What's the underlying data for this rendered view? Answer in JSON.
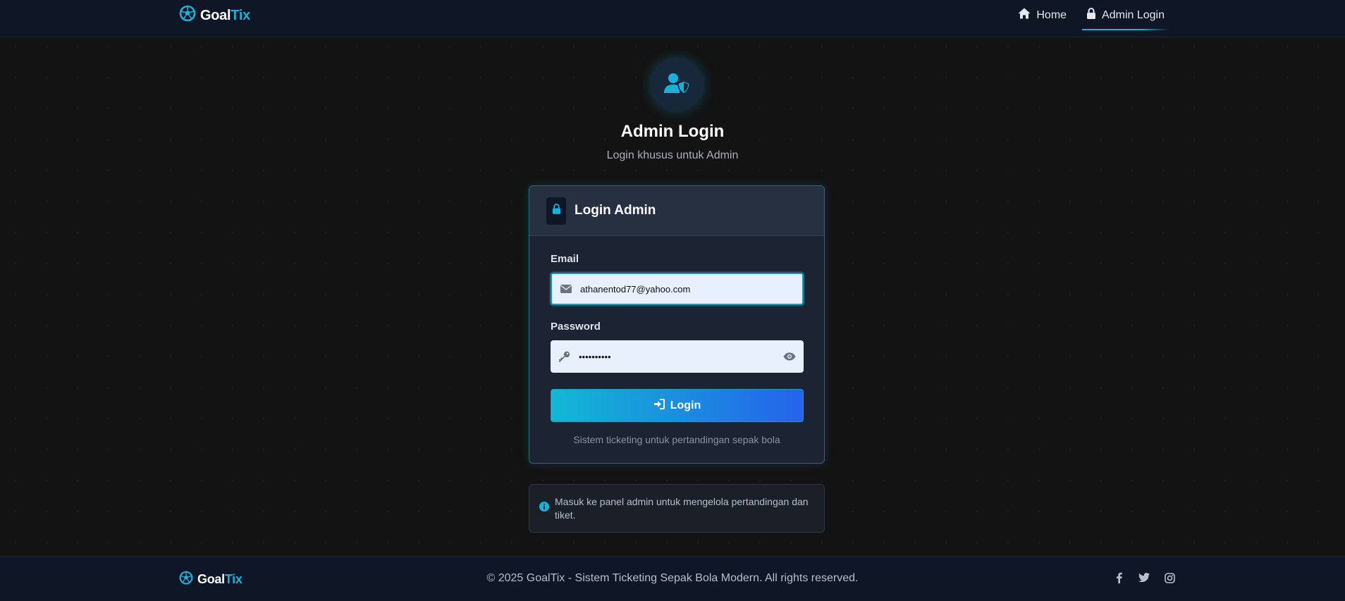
{
  "nav": {
    "brand_part1": "Goal",
    "brand_part2": "Tix",
    "links": [
      {
        "label": "Home",
        "icon": "home-icon"
      },
      {
        "label": "Admin Login",
        "icon": "lock-icon",
        "active": true
      }
    ]
  },
  "hero": {
    "icon": "user-shield-icon",
    "title": "Admin Login",
    "subtitle": "Login khusus untuk Admin"
  },
  "card": {
    "title": "Login Admin",
    "email_label": "Email",
    "email_value": "athanentod77@yahoo.com",
    "password_label": "Password",
    "password_value": "••••••••••",
    "login_label": "Login",
    "footnote": "Sistem ticketing untuk pertandingan sepak bola"
  },
  "info": {
    "text": "Masuk ke panel admin untuk mengelola pertandingan dan tiket."
  },
  "footer": {
    "brand_part1": "Goal",
    "brand_part2": "Tix",
    "copyright": "© 2025 GoalTix - Sistem Ticketing Sepak Bola Modern. All rights reserved.",
    "social": [
      "facebook-icon",
      "twitter-icon",
      "instagram-icon"
    ]
  },
  "colors": {
    "accent": "#1ab0d9",
    "button_gradient_start": "#12b8d4",
    "button_gradient_end": "#2563eb",
    "background": "#131313",
    "navbar": "#0f1726"
  }
}
